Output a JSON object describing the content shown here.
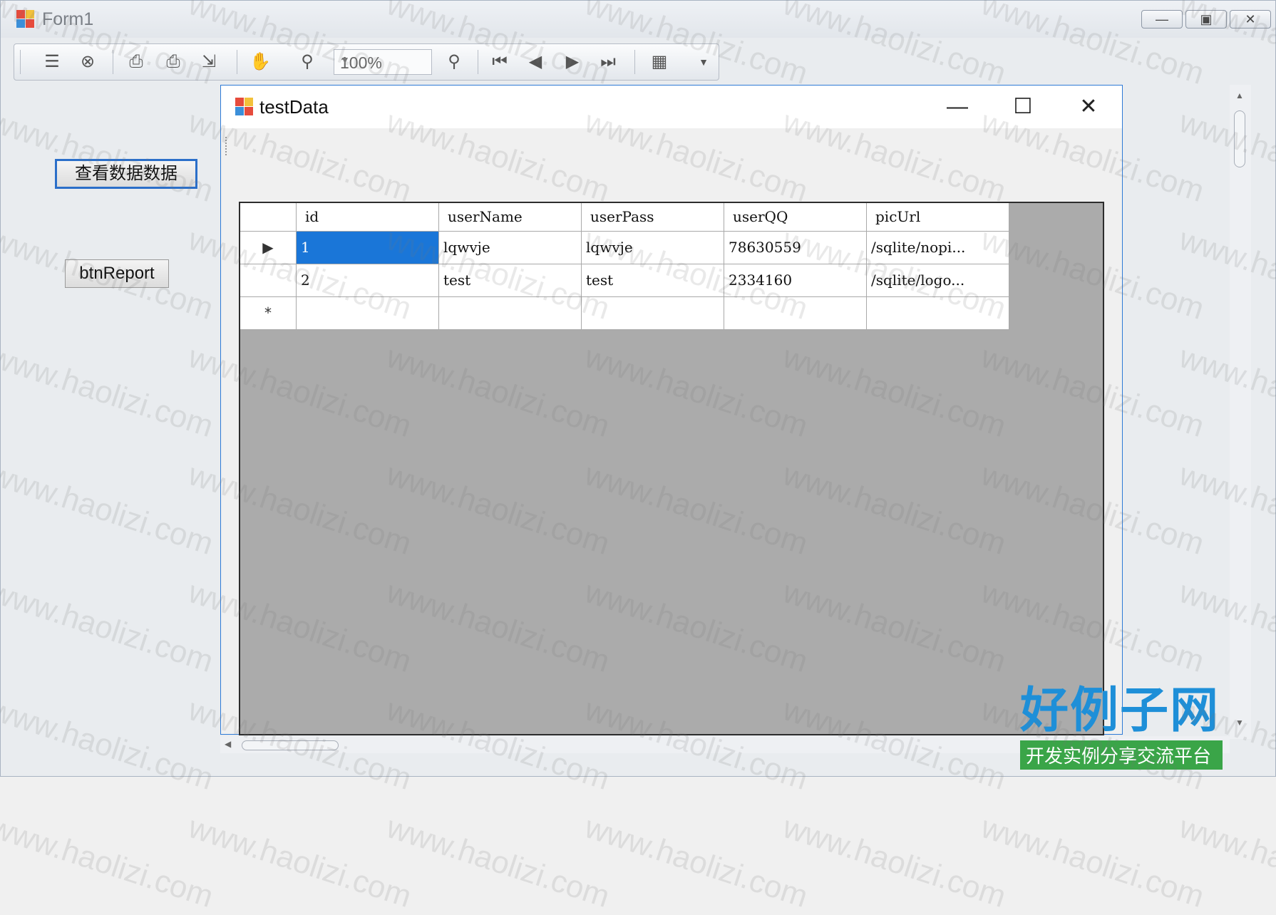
{
  "window": {
    "title": "Form1"
  },
  "titlebar_buttons": {
    "minimize": "—",
    "maximize": "▣",
    "close": "✕"
  },
  "toolbar": {
    "zoom_value": "100%",
    "icons": [
      "toggle-tree-icon",
      "binoculars-icon",
      "page-setup-icon",
      "print-icon",
      "export-icon",
      "hand-icon",
      "zoom-out-icon",
      "zoom-in-icon",
      "first-page-icon",
      "prev-page-icon",
      "next-page-icon",
      "last-page-icon",
      "layout-icon"
    ]
  },
  "buttons": {
    "view_data": "查看数据数据",
    "report": "btnReport"
  },
  "child_window": {
    "title": "testData",
    "minimize": "—",
    "maximize": "☐",
    "close": "✕"
  },
  "grid": {
    "columns": [
      "id",
      "userName",
      "userPass",
      "userQQ",
      "picUrl"
    ],
    "rows": [
      {
        "marker": "▶",
        "cells": [
          "1",
          "lqwvje",
          "lqwvje",
          "78630559",
          "/sqlite/nopi..."
        ]
      },
      {
        "marker": "",
        "cells": [
          "2",
          "test",
          "test",
          "2334160",
          "/sqlite/logo..."
        ]
      },
      {
        "marker": "*",
        "cells": [
          "",
          "",
          "",
          "",
          ""
        ]
      }
    ]
  },
  "watermark": {
    "logo_title": "好例子网",
    "logo_subtitle": "开发实例分享交流平台",
    "text": "www.haolizi.com"
  },
  "colors": {
    "selection": "#1a76d8",
    "grid_bg": "#ababab",
    "focus_border": "#2b6fc9",
    "logo_blue": "#1e8fd8",
    "logo_green": "#3aa548"
  }
}
